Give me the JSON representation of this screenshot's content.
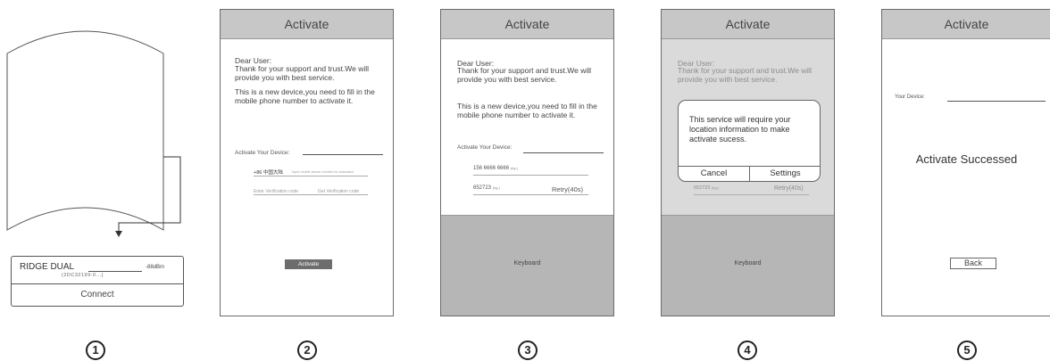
{
  "step_numbers": [
    "1",
    "2",
    "3",
    "4",
    "5"
  ],
  "panel1": {
    "device_name": "RIDGE DUAL",
    "signal": "-88dBm",
    "device_id": "(2DC32199-0...)",
    "connect_label": "Connect"
  },
  "panel2": {
    "title": "Activate",
    "greeting": "Dear User:",
    "thanks": "Thank for your support and trust.We will provide you with best service.",
    "notice": "This is a new device,you need to fill in the mobile phone number to activate it.",
    "device_label": "Activate Your Device:",
    "country_code": "+86 中国大陆",
    "phone_placeholder": "Input mobile phone number for activation",
    "code_placeholder": "Enter Verification code",
    "get_code": "Get Verification code",
    "activate_button": "Activate"
  },
  "panel3": {
    "title": "Activate",
    "greeting": "Dear User:",
    "thanks": "Thank for your support and trust.We will provide you with best service.",
    "notice": "This is a new device,you need to fill in the mobile phone number to activate it.",
    "device_label": "Activate Your Device:",
    "phone_value": "156 6666 6666",
    "phone_suffix": "(eg.)",
    "code_value": "652723",
    "code_suffix": "(eg.)",
    "retry": "Retry(40s)",
    "keyboard": "Keyboard"
  },
  "panel4": {
    "title": "Activate",
    "greeting": "Dear User:",
    "thanks": "Thank for your support and trust.We will provide you with best service.",
    "dialog_text": "This service will require your location information to make activate sucess.",
    "cancel": "Cancel",
    "settings": "Settings",
    "code_value": "652723",
    "code_suffix": "(eg.)",
    "retry": "Retry(40s)",
    "keyboard": "Keyboard"
  },
  "panel5": {
    "title": "Activate",
    "device_label": "Your Device:",
    "success": "Activate Successed",
    "back": "Back"
  }
}
